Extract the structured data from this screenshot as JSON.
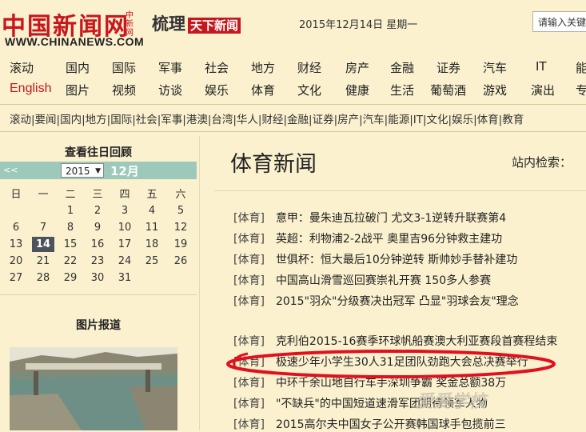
{
  "header": {
    "logo_cn": "中国新闻网",
    "logo_side": "中新网",
    "logo_en": "WWW.CHINANEWS.COM",
    "slogan_main": "梳理",
    "slogan_red": "天下新闻",
    "date": "2015年12月14日 星期一",
    "search_placeholder": "请输入关键"
  },
  "nav_row1": [
    "滚动",
    "国内",
    "国际",
    "军事",
    "社会",
    "地方",
    "财经",
    "房产",
    "金融",
    "证券",
    "汽车",
    "IT",
    "能"
  ],
  "nav_row2": [
    "English",
    "图片",
    "视频",
    "访谈",
    "娱乐",
    "体育",
    "文化",
    "健康",
    "生活",
    "葡萄酒",
    "游戏",
    "演出",
    "专"
  ],
  "subnav": "滚动|要闻|国内|地方|国际|社会|军事|港澳|台湾|华人|财经|金融|证券|房产|汽车|能源|IT|文化|娱乐|体育|教育",
  "calendar": {
    "title": "查看往日回顾",
    "prev": "<<",
    "year": "2015",
    "month": "12月",
    "weekdays": [
      "日",
      "一",
      "二",
      "三",
      "四",
      "五",
      "六"
    ],
    "weeks": [
      [
        "",
        "",
        "1",
        "2",
        "3",
        "4",
        "5"
      ],
      [
        "6",
        "7",
        "8",
        "9",
        "10",
        "11",
        "12"
      ],
      [
        "13",
        "14",
        "15",
        "16",
        "17",
        "18",
        "19"
      ],
      [
        "20",
        "21",
        "22",
        "23",
        "24",
        "25",
        "26"
      ],
      [
        "27",
        "28",
        "29",
        "30",
        "31",
        "",
        ""
      ]
    ],
    "today": "14"
  },
  "photo_section": {
    "title": "图片报道"
  },
  "main": {
    "title": "体育新闻",
    "site_search_label": "站内检索：",
    "news": [
      {
        "tag": "[体育]",
        "title": "意甲：曼朱迪瓦拉破门 尤文3-1逆转升联赛第4"
      },
      {
        "tag": "[体育]",
        "title": "英超：利物浦2-2战平 奥里吉96分钟救主建功"
      },
      {
        "tag": "[体育]",
        "title": "世俱杯：恒大最后10分钟逆转 斯帅妙手替补建功"
      },
      {
        "tag": "[体育]",
        "title": "中国高山滑雪巡回赛崇礼开赛 150多人参赛"
      },
      {
        "tag": "[体育]",
        "title": "2015\"羽众\"分级赛决出冠军 凸显\"羽球会友\"理念"
      },
      {
        "tag": "[体育]",
        "title": "克利伯2015-16赛季环球帆船赛澳大利亚赛段首赛程结束"
      },
      {
        "tag": "[体育]",
        "title": "极速少年小学生30人31足团队劲跑大会总决赛举行"
      },
      {
        "tag": "[体育]",
        "title": "中环千余山地自行车手深圳争霸 奖金总额38万"
      },
      {
        "tag": "[体育]",
        "title": "\"不缺兵\"的中国短道速滑军团期待领军人物"
      },
      {
        "tag": "[体育]",
        "title": "2015高尔夫中国女子公开赛韩国球手包揽前三"
      }
    ]
  },
  "watermark": "爱爱学校",
  "colors": {
    "brand_red": "#c8161d",
    "calendar_bar": "#9cc9b9",
    "page_bg": "#fbf1cf",
    "circle_red": "#e0101e"
  }
}
